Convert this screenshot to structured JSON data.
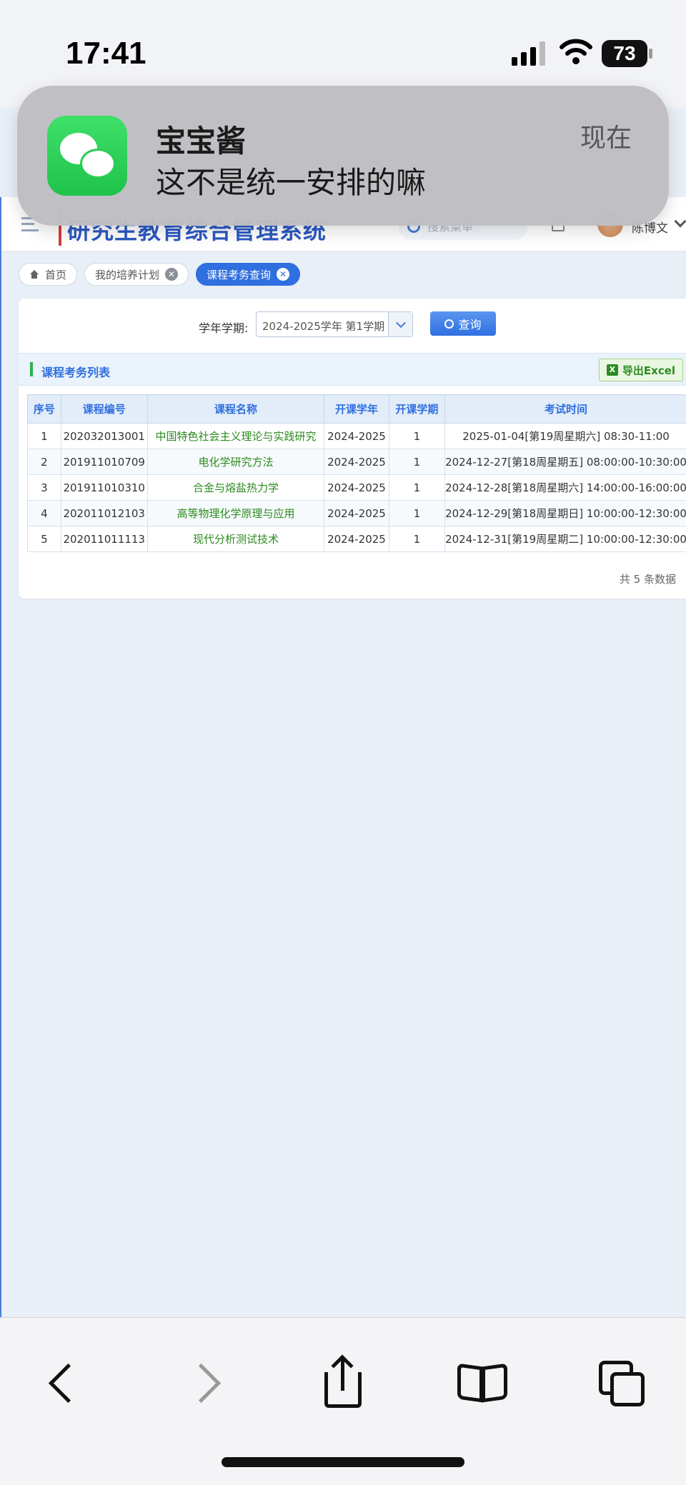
{
  "status_bar": {
    "time": "17:41",
    "battery": "73"
  },
  "app": {
    "title": "研究生教育综合管理系统",
    "search_placeholder": "搜索菜单",
    "user_name": "陈博文"
  },
  "tabs": [
    {
      "label": "首页",
      "icon": "home-icon"
    },
    {
      "label": "我的培养计划",
      "closable": true
    },
    {
      "label": "课程考务查询",
      "closable": true,
      "active": true
    }
  ],
  "filter": {
    "label": "学年学期:",
    "value": "2024-2025学年 第1学期",
    "query_label": "查询"
  },
  "list": {
    "title": "课程考务列表",
    "export_label": "导出Excel",
    "columns": [
      "序号",
      "课程编号",
      "课程名称",
      "开课学年",
      "开课学期",
      "考试时间"
    ],
    "rows": [
      [
        "1",
        "202032013001",
        "中国特色社会主义理论与实践研究",
        "2024-2025",
        "1",
        "2025-01-04[第19周星期六] 08:30-11:00"
      ],
      [
        "2",
        "201911010709",
        "电化学研究方法",
        "2024-2025",
        "1",
        "2024-12-27[第18周星期五] 08:00:00-10:30:00"
      ],
      [
        "3",
        "201911010310",
        "合金与熔盐热力学",
        "2024-2025",
        "1",
        "2024-12-28[第18周星期六] 14:00:00-16:00:00"
      ],
      [
        "4",
        "202011012103",
        "高等物理化学原理与应用",
        "2024-2025",
        "1",
        "2024-12-29[第18周星期日] 10:00:00-12:30:00"
      ],
      [
        "5",
        "202011011113",
        "现代分析测试技术",
        "2024-2025",
        "1",
        "2024-12-31[第19周星期二] 10:00:00-12:30:00"
      ]
    ],
    "total_text": "共 5 条数据"
  },
  "notification": {
    "app_icon": "wechat-icon",
    "sender": "宝宝酱",
    "message": "这不是统一安排的嘛",
    "time": "现在"
  },
  "colors": {
    "accent": "#2f6fe0",
    "course_name": "#2b8a1e",
    "wechat_green": "#1fc24a"
  }
}
